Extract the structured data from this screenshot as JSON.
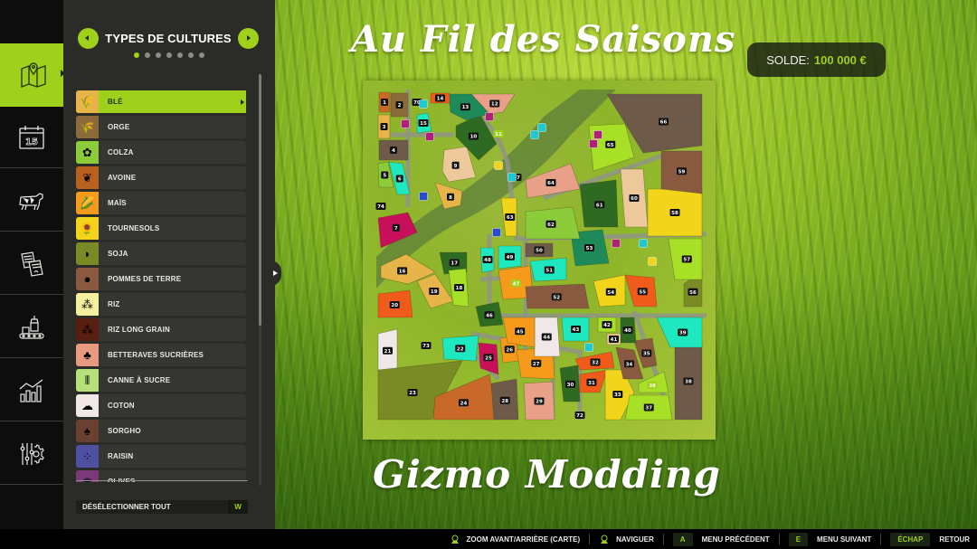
{
  "header": {
    "title_top": "Au Fil des Saisons",
    "title_bottom": "Gizmo Modding",
    "balance_label": "SOLDE:",
    "balance_value": "100 000 €"
  },
  "rail": {
    "items": [
      {
        "name": "map-icon",
        "label": "Carte",
        "active": true
      },
      {
        "name": "calendar-icon",
        "label": "Calendrier",
        "day": "15"
      },
      {
        "name": "cow-icon",
        "label": "Animaux"
      },
      {
        "name": "contracts-icon",
        "label": "Contrats"
      },
      {
        "name": "production-icon",
        "label": "Production"
      },
      {
        "name": "statistics-icon",
        "label": "Statistiques"
      },
      {
        "name": "settings-icon",
        "label": "Paramètres"
      }
    ]
  },
  "panel": {
    "title": "TYPES DE CULTURES",
    "page_count": 7,
    "active_page": 1,
    "deselect_label": "DÉSÉLECTIONNER TOUT",
    "deselect_key": "W",
    "crops": [
      {
        "label": "BLÉ",
        "color": "#e7b44a",
        "icon": "wheat-icon",
        "glyph": "🌾",
        "selected": true
      },
      {
        "label": "ORGE",
        "color": "#8c6a3a",
        "icon": "barley-icon",
        "glyph": "🌾"
      },
      {
        "label": "COLZA",
        "color": "#8ccc3a",
        "icon": "canola-icon",
        "glyph": "✿"
      },
      {
        "label": "AVOINE",
        "color": "#b8601e",
        "icon": "oat-icon",
        "glyph": "❦"
      },
      {
        "label": "MAÏS",
        "color": "#f59a1a",
        "icon": "corn-icon",
        "glyph": "🌽"
      },
      {
        "label": "TOURNESOLS",
        "color": "#f2d51a",
        "icon": "sunflower-icon",
        "glyph": "🌻"
      },
      {
        "label": "SOJA",
        "color": "#7a8a24",
        "icon": "soybean-icon",
        "glyph": "◗"
      },
      {
        "label": "POMMES DE TERRE",
        "color": "#8a5a40",
        "icon": "potato-icon",
        "glyph": "●"
      },
      {
        "label": "RIZ",
        "color": "#f5f0a0",
        "icon": "rice-icon",
        "glyph": "⁂"
      },
      {
        "label": "RIZ LONG GRAIN",
        "color": "#5a1e10",
        "icon": "long-grain-rice-icon",
        "glyph": "⁂"
      },
      {
        "label": "BETTERAVES SUCRIÈRES",
        "color": "#e89a80",
        "icon": "sugarbeet-icon",
        "glyph": "♣"
      },
      {
        "label": "CANNE À SUCRE",
        "color": "#b5e07a",
        "icon": "sugarcane-icon",
        "glyph": "⦀"
      },
      {
        "label": "COTON",
        "color": "#f0e8e8",
        "icon": "cotton-icon",
        "glyph": "☁"
      },
      {
        "label": "SORGHO",
        "color": "#6a4030",
        "icon": "sorghum-icon",
        "glyph": "♠"
      },
      {
        "label": "RAISIN",
        "color": "#5050a0",
        "icon": "grape-icon",
        "glyph": "⁘"
      },
      {
        "label": "OLIVES",
        "color": "#7a3a7a",
        "icon": "olive-icon",
        "glyph": "◉"
      }
    ]
  },
  "map": {
    "fields": [
      {
        "id": "1",
        "color": "#c8692a"
      },
      {
        "id": "2",
        "color": "#8c6a3a"
      },
      {
        "id": "3",
        "color": "#e7b44a"
      },
      {
        "id": "4",
        "color": "#6e5a48"
      },
      {
        "id": "5",
        "color": "#8ccc3a"
      },
      {
        "id": "6",
        "color": "#1ee8c0"
      },
      {
        "id": "7",
        "color": "#c8105a"
      },
      {
        "id": "8",
        "color": "#e7b44a"
      },
      {
        "id": "9",
        "color": "#ecc89a"
      },
      {
        "id": "10",
        "color": "#2e6a22"
      },
      {
        "id": "11",
        "color": "#8aa83a"
      },
      {
        "id": "12",
        "color": "#e8a088"
      },
      {
        "id": "13",
        "color": "#1e8a5a"
      },
      {
        "id": "14",
        "color": "#f05a1a"
      },
      {
        "id": "15",
        "color": "#1ee8c0"
      },
      {
        "id": "16",
        "color": "#e7b44a"
      },
      {
        "id": "17",
        "color": "#2e6a22"
      },
      {
        "id": "18",
        "color": "#a8e028"
      },
      {
        "id": "19",
        "color": "#e7b44a"
      },
      {
        "id": "20",
        "color": "#f05a1a"
      },
      {
        "id": "21",
        "color": "#f0e8e8"
      },
      {
        "id": "22",
        "color": "#1ee8c0"
      },
      {
        "id": "23",
        "color": "#7a8a24"
      },
      {
        "id": "24",
        "color": "#c8692a"
      },
      {
        "id": "25",
        "color": "#c8105a"
      },
      {
        "id": "26",
        "color": "#f59a1a"
      },
      {
        "id": "27",
        "color": "#f59a1a"
      },
      {
        "id": "28",
        "color": "#6e5a48"
      },
      {
        "id": "29",
        "color": "#e8a088"
      },
      {
        "id": "30",
        "color": "#2e6a22"
      },
      {
        "id": "31",
        "color": "#f05a1a"
      },
      {
        "id": "32",
        "color": "#f05a1a"
      },
      {
        "id": "33",
        "color": "#f2d51a"
      },
      {
        "id": "34",
        "color": "#8a5a40"
      },
      {
        "id": "35",
        "color": "#8a5a40"
      },
      {
        "id": "36",
        "color": "#a8e028"
      },
      {
        "id": "37",
        "color": "#a8e028"
      },
      {
        "id": "38",
        "color": "#6e5a48"
      },
      {
        "id": "39",
        "color": "#1ee8c0"
      },
      {
        "id": "40",
        "color": "#2e6a22"
      },
      {
        "id": "41",
        "color": "#ecc89a"
      },
      {
        "id": "42",
        "color": "#a8e028"
      },
      {
        "id": "43",
        "color": "#1ee8c0"
      },
      {
        "id": "44",
        "color": "#f0e8e8"
      },
      {
        "id": "45",
        "color": "#f59a1a"
      },
      {
        "id": "46",
        "color": "#2e6a22"
      },
      {
        "id": "47",
        "color": "#f59a1a"
      },
      {
        "id": "48",
        "color": "#1ee8c0"
      },
      {
        "id": "49",
        "color": "#1ee8c0"
      },
      {
        "id": "50",
        "color": "#6e5a48"
      },
      {
        "id": "51",
        "color": "#1ee8c0"
      },
      {
        "id": "52",
        "color": "#8a5a40"
      },
      {
        "id": "53",
        "color": "#1e8a5a"
      },
      {
        "id": "54",
        "color": "#f2d51a"
      },
      {
        "id": "55",
        "color": "#f05a1a"
      },
      {
        "id": "56",
        "color": "#7a8a24"
      },
      {
        "id": "57",
        "color": "#a8e028"
      },
      {
        "id": "58",
        "color": "#f2d51a"
      },
      {
        "id": "59",
        "color": "#8a5a40"
      },
      {
        "id": "60",
        "color": "#ecc89a"
      },
      {
        "id": "61",
        "color": "#2e6a22"
      },
      {
        "id": "62",
        "color": "#8ccc3a"
      },
      {
        "id": "63",
        "color": "#f2d51a"
      },
      {
        "id": "64",
        "color": "#e8a088"
      },
      {
        "id": "65",
        "color": "#a8e028"
      },
      {
        "id": "66",
        "color": "#6e5a48"
      },
      {
        "id": "67",
        "color": "#8aa83a"
      },
      {
        "id": "70",
        "color": "#8aa83a"
      },
      {
        "id": "72",
        "color": "#8aa83a"
      },
      {
        "id": "73",
        "color": "#8aa83a"
      },
      {
        "id": "74",
        "color": "#8aa83a"
      }
    ]
  },
  "footer": {
    "hints": [
      {
        "key": "",
        "icon": "gamepad-stick-icon",
        "label": "ZOOM AVANT/ARRIÈRE (CARTE)"
      },
      {
        "key": "",
        "icon": "gamepad-dpad-icon",
        "label": "NAVIGUER"
      },
      {
        "key": "A",
        "label": "MENU PRÉCÉDENT"
      },
      {
        "key": "E",
        "label": "MENU SUIVANT"
      },
      {
        "key": "ÉCHAP",
        "label": "RETOUR"
      }
    ]
  },
  "colors": {
    "accent": "#9fd01b",
    "panel_bg": "#2b2c28",
    "rail_bg": "#0d0d0d"
  }
}
